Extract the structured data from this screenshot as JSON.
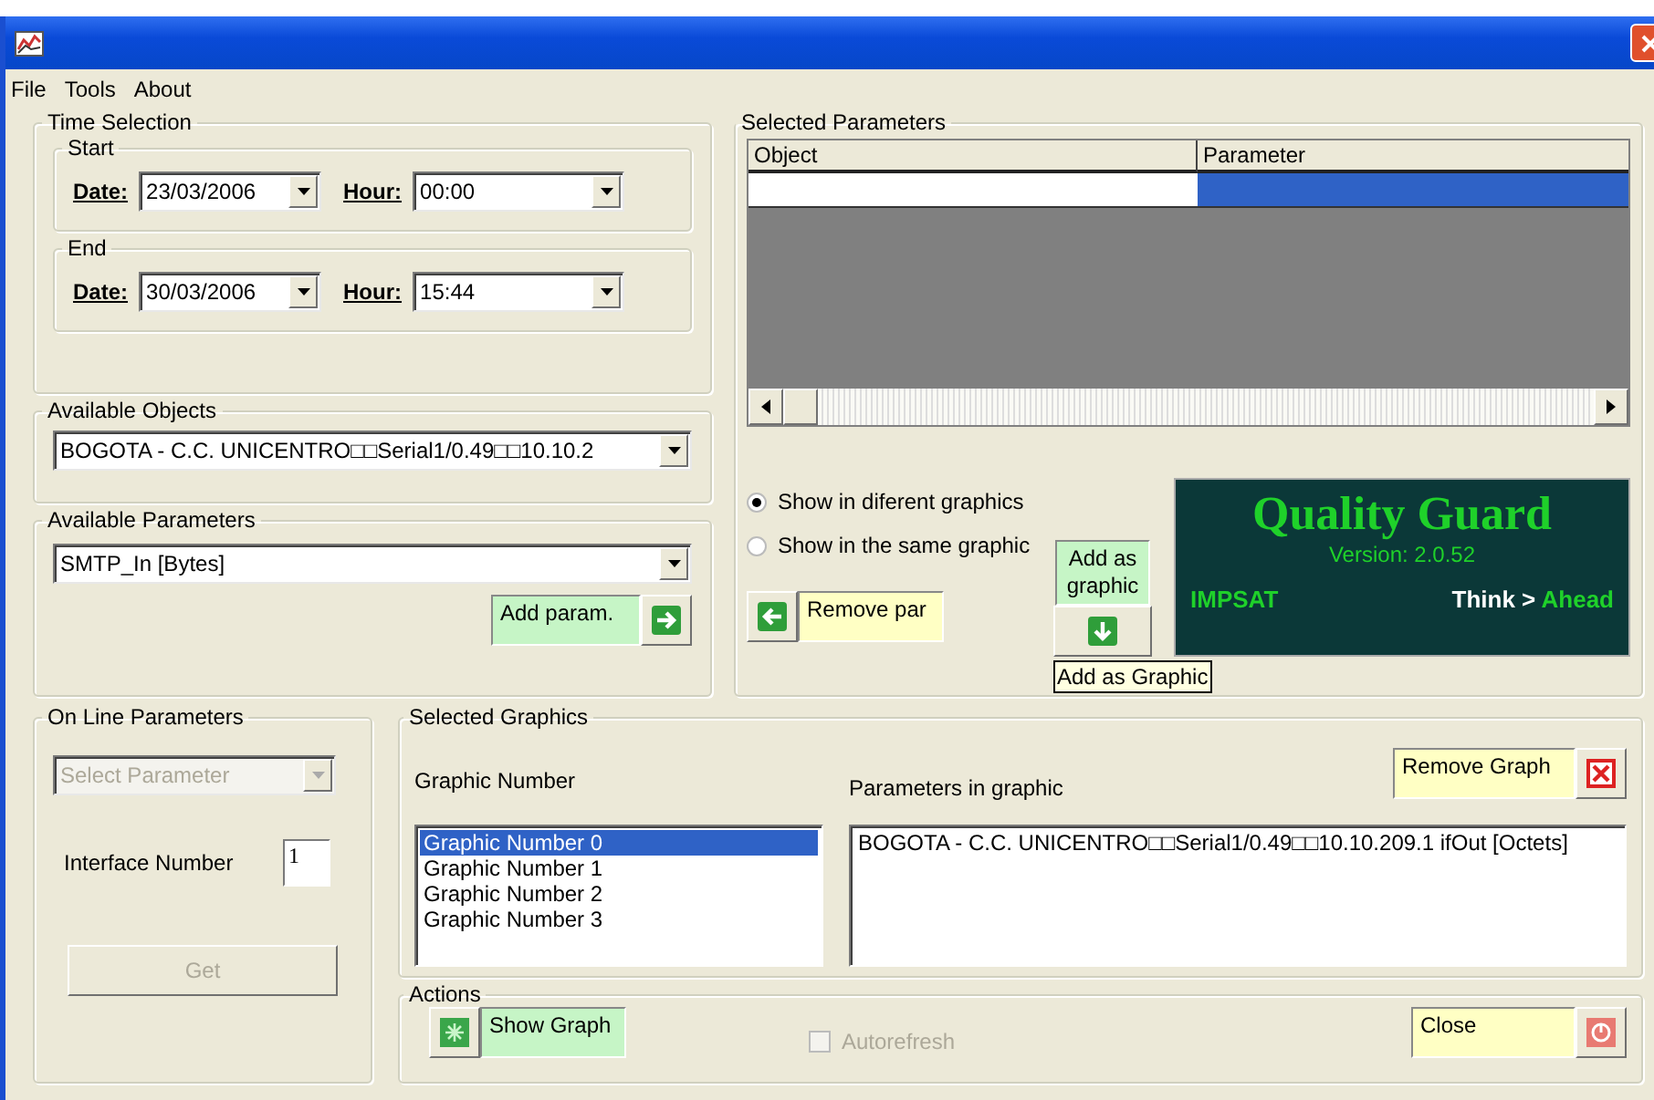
{
  "menu": [
    {
      "label": "File"
    },
    {
      "label": "Tools"
    },
    {
      "label": "About"
    }
  ],
  "time_selection": {
    "title": "Time Selection",
    "ranges": [
      {
        "title": "Start",
        "date_label": "Date:",
        "date": "23/03/2006",
        "hour_label": "Hour:",
        "hour": "00:00"
      },
      {
        "title": "End",
        "date_label": "Date:",
        "date": "30/03/2006",
        "hour_label": "Hour:",
        "hour": "15:44"
      }
    ]
  },
  "available_objects": {
    "title": "Available Objects",
    "value": "BOGOTA - C.C. UNICENTRO□□Serial1/0.49□□10.10.2"
  },
  "available_parameters": {
    "title": "Available Parameters",
    "value": "SMTP_In [Bytes]",
    "add_button": "Add param."
  },
  "selected_parameters": {
    "title": "Selected Parameters",
    "columns": [
      "Object",
      "Parameter"
    ],
    "rows": [
      {
        "selected": true
      }
    ],
    "options": [
      {
        "label": "Show in diferent graphics",
        "selected": true
      },
      {
        "label": "Show in the same graphic",
        "selected": false
      }
    ],
    "remove_button": "Remove par",
    "add_graphic_button": "Add as graphic",
    "tooltip": "Add as Graphic"
  },
  "logo": {
    "title": "Quality Guard",
    "version": "Version: 2.0.52",
    "company": "IMPSAT",
    "slogan_lead": "Think >",
    "slogan_tail": "Ahead"
  },
  "online_parameters": {
    "title": "On Line Parameters",
    "select": {
      "placeholder": "Select Parameter",
      "disabled": true
    },
    "interface_label": "Interface Number",
    "interface_value": "1",
    "get_button": {
      "label": "Get",
      "disabled": true
    }
  },
  "selected_graphics": {
    "title": "Selected Graphics",
    "graphic_number_label": "Graphic Number",
    "graphics": [
      {
        "label": "Graphic Number 0",
        "selected": true
      },
      {
        "label": "Graphic Number 1",
        "selected": false
      },
      {
        "label": "Graphic Number 2",
        "selected": false
      },
      {
        "label": "Graphic Number 3",
        "selected": false
      }
    ],
    "params_label": "Parameters in graphic",
    "params": [
      "BOGOTA - C.C. UNICENTRO□□Serial1/0.49□□10.10.209.1 ifOut [Octets]"
    ],
    "remove_button": "Remove Graph"
  },
  "actions": {
    "title": "Actions",
    "show_graph": "Show Graph",
    "autorefresh": {
      "label": "Autorefresh",
      "checked": false,
      "disabled": true
    },
    "close": "Close"
  }
}
